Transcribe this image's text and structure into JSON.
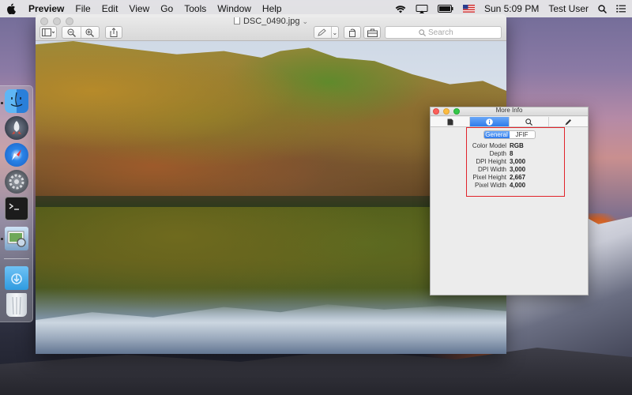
{
  "menubar": {
    "app_name": "Preview",
    "menus": [
      "File",
      "Edit",
      "View",
      "Go",
      "Tools",
      "Window",
      "Help"
    ],
    "clock": "Sun 5:09 PM",
    "user": "Test User"
  },
  "dock": {
    "items": [
      "finder-icon",
      "launchpad-icon",
      "safari-icon",
      "system-preferences-icon",
      "terminal-icon",
      "preview-icon",
      "downloads-folder-icon",
      "trash-icon"
    ]
  },
  "preview_window": {
    "title": "DSC_0490.jpg",
    "search_placeholder": "Search"
  },
  "more_info": {
    "title": "More Info",
    "tabs": [
      "general-info-icon",
      "more-info-icon",
      "search-icon",
      "edit-icon"
    ],
    "selected_tab": 1,
    "segments": [
      "General",
      "JFIF"
    ],
    "selected_segment": 0,
    "properties": [
      {
        "key": "Color Model",
        "value": "RGB"
      },
      {
        "key": "Depth",
        "value": "8"
      },
      {
        "key": "DPI Height",
        "value": "3,000"
      },
      {
        "key": "DPI Width",
        "value": "3,000"
      },
      {
        "key": "Pixel Height",
        "value": "2,667"
      },
      {
        "key": "Pixel Width",
        "value": "4,000"
      }
    ]
  },
  "colors": {
    "accent": "#2f7bec",
    "highlight": "#e1232a"
  }
}
